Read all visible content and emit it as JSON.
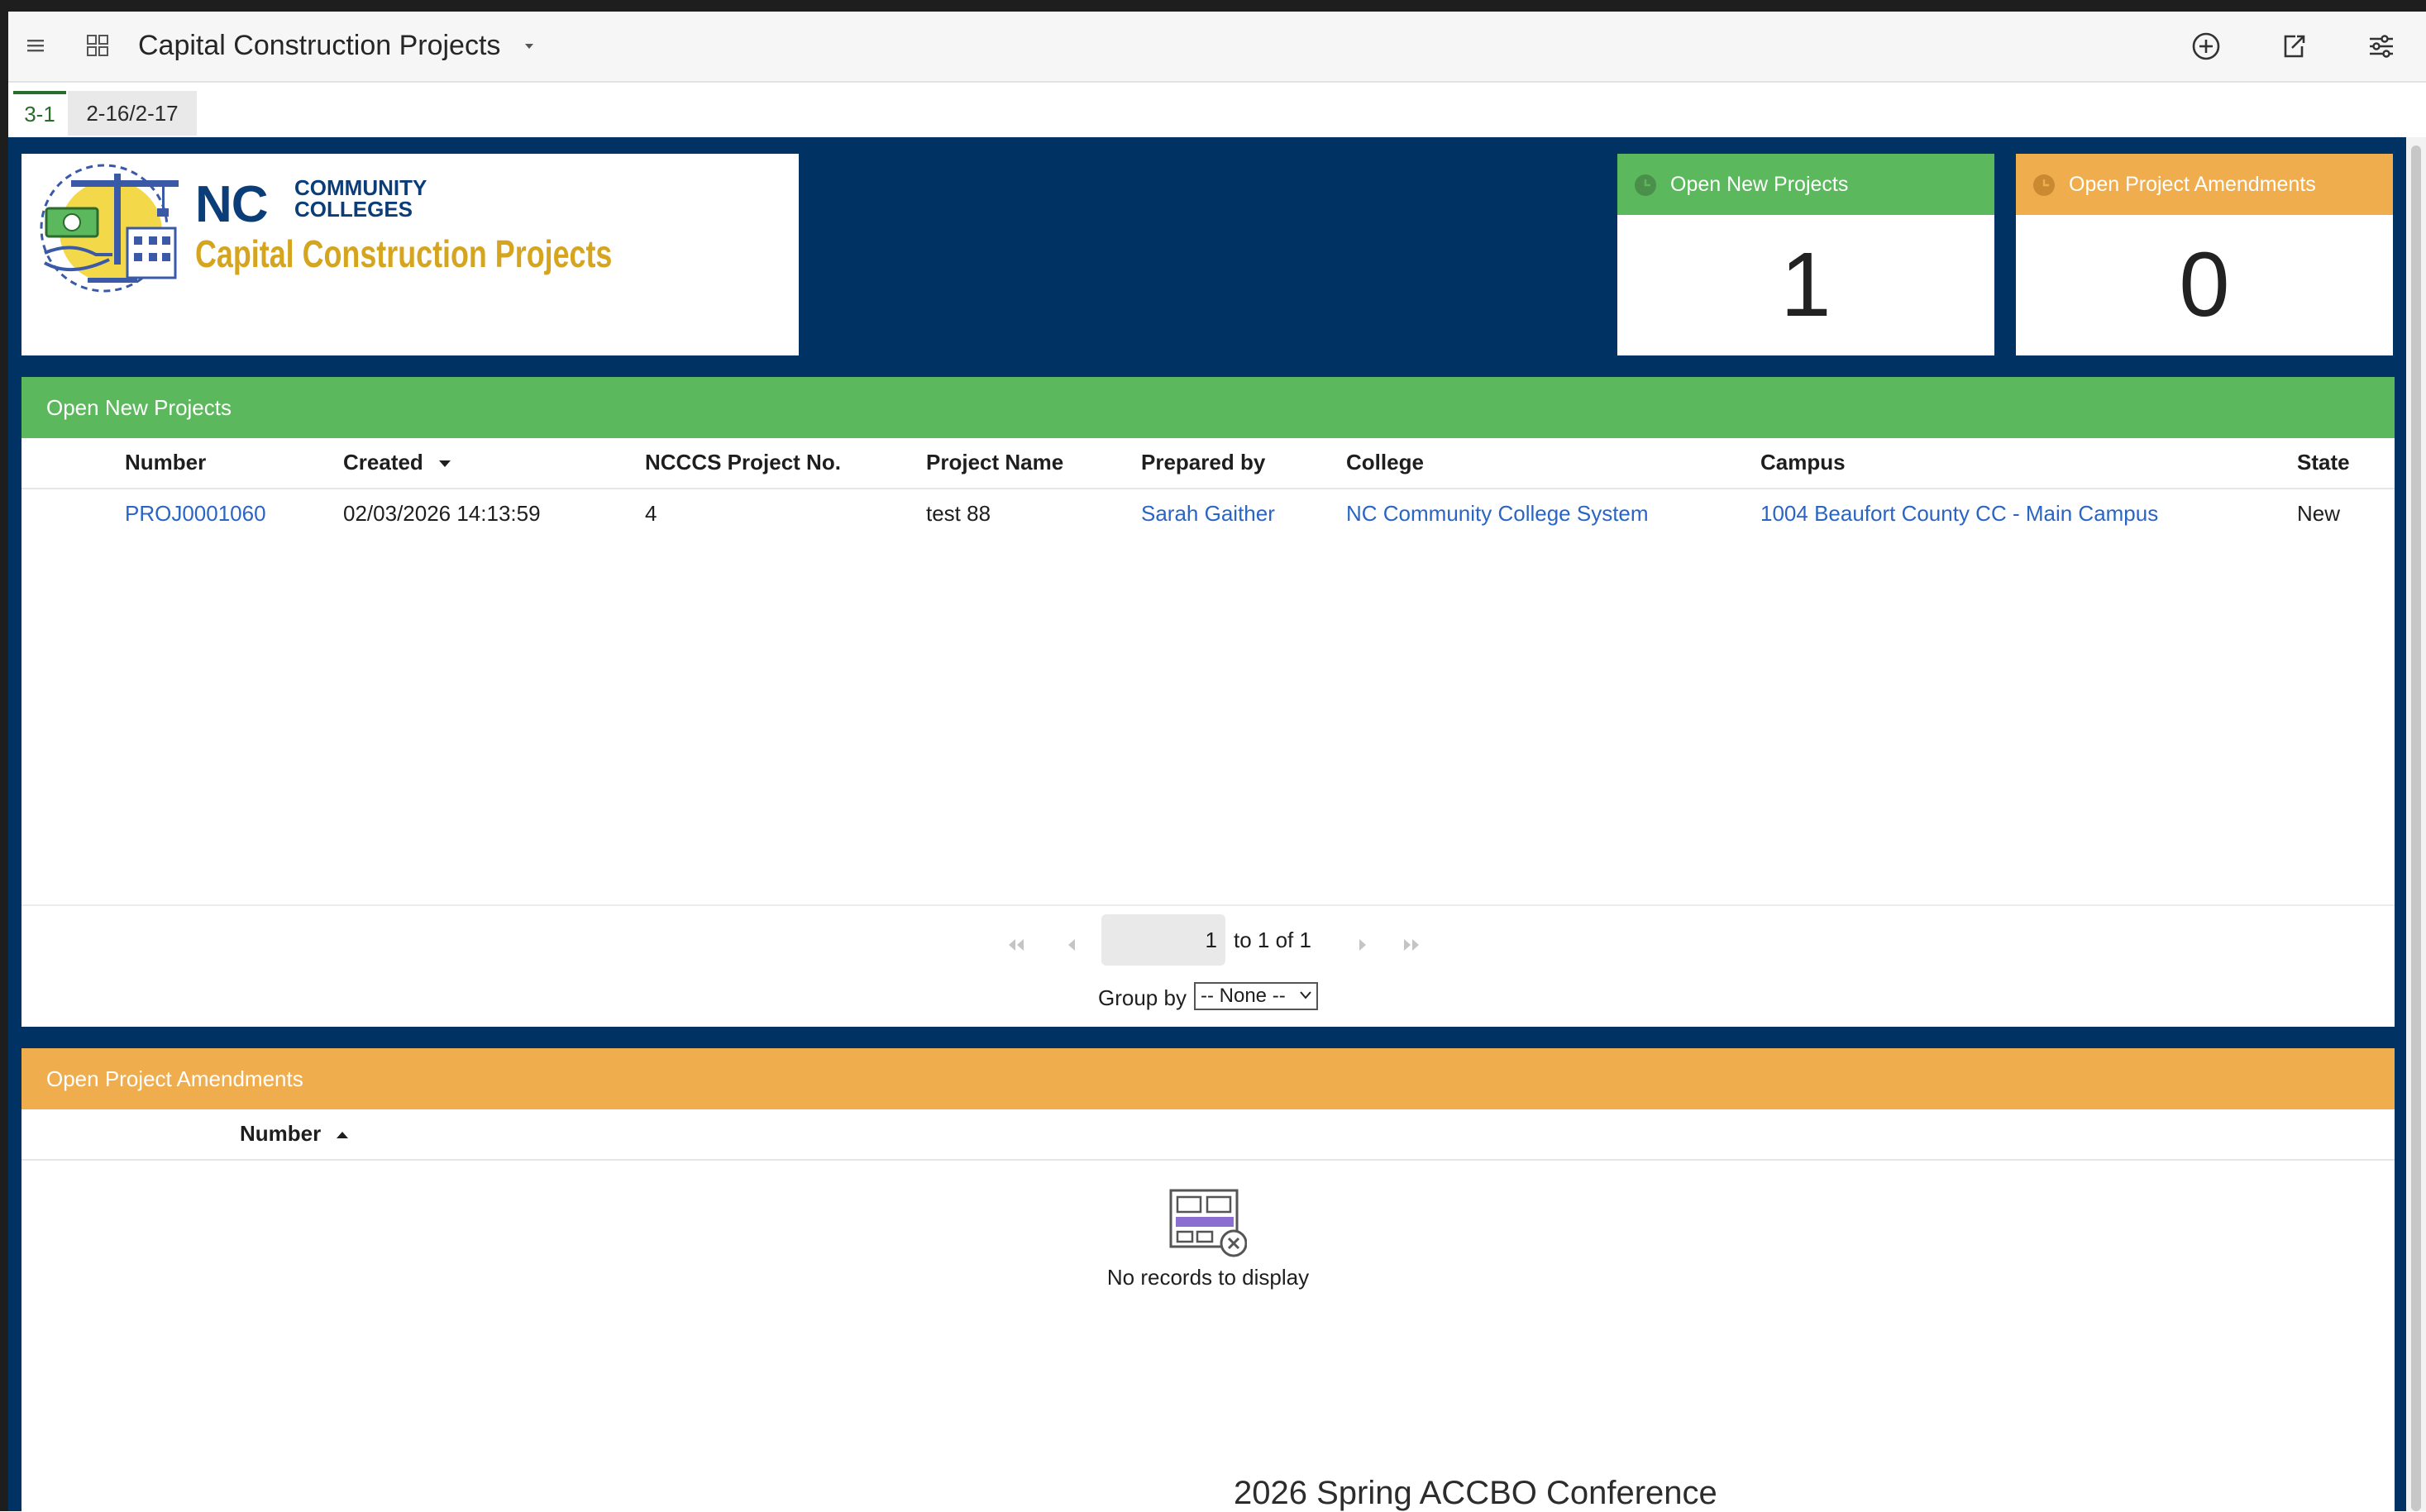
{
  "app": {
    "title": "Capital Construction Projects"
  },
  "tabs": [
    {
      "label": "3-1",
      "active": true
    },
    {
      "label": "2-16/2-17",
      "active": false
    }
  ],
  "logo": {
    "nc": "NC",
    "community": "COMMUNITY",
    "colleges": "COLLEGES",
    "subtitle": "Capital Construction Projects"
  },
  "stats": {
    "new_projects": {
      "label": "Open New Projects",
      "value": "1",
      "color": "#5cb85c"
    },
    "amendments": {
      "label": "Open Project Amendments",
      "value": "0",
      "color": "#f0ad4e"
    }
  },
  "new_projects_panel": {
    "title": "Open New Projects",
    "columns": [
      "Number",
      "Created",
      "NCCCS Project No.",
      "Project Name",
      "Prepared by",
      "College",
      "Campus",
      "State"
    ],
    "rows": [
      {
        "number": "PROJ0001060",
        "created": "02/03/2026 14:13:59",
        "ncccs_no": "4",
        "project_name": "test 88",
        "prepared_by": "Sarah Gaither",
        "college": "NC Community College System",
        "campus": "1004 Beaufort County CC - Main Campus",
        "state": "New"
      }
    ],
    "pager": {
      "page": "1",
      "of_text": "to 1 of 1",
      "group_by_label": "Group by",
      "group_by_value": "-- None --"
    }
  },
  "amendments_panel": {
    "title": "Open Project Amendments",
    "columns": [
      "Number"
    ],
    "empty_text": "No records to display"
  },
  "footer": {
    "watermark": "2026 Spring ACCBO Conference"
  },
  "colors": {
    "canvas": "#003264",
    "green": "#5cb85c",
    "orange": "#f0ad4e",
    "link": "#2a65c4"
  }
}
